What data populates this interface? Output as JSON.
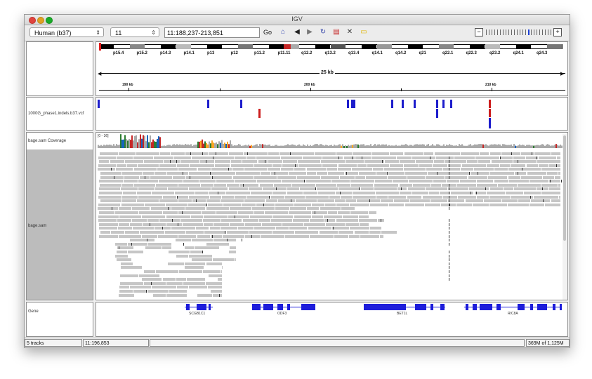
{
  "window": {
    "title": "IGV"
  },
  "toolbar": {
    "genome": "Human (b37)",
    "chromosome": "11",
    "locus": "11:188,237-213,851",
    "go_label": "Go",
    "zoom_minus": "−",
    "zoom_plus": "+"
  },
  "ideogram": {
    "bands": [
      "p15.4",
      "p15.2",
      "p14.3",
      "p14.1",
      "p13",
      "p12",
      "p11.2",
      "p11.11",
      "q12.2",
      "q13.2",
      "q13.4",
      "q14.1",
      "q14.2",
      "q21",
      "q22.1",
      "q22.3",
      "q23.2",
      "q24.1",
      "q24.3"
    ]
  },
  "ruler": {
    "span": "25 kb",
    "ticks": [
      "190 kb",
      "200 kb",
      "210 kb"
    ]
  },
  "tracks": {
    "vcf": "1000G_phase1.indels.b37.vcf",
    "coverage": "bage.sam Coverage",
    "coverage_range": "[0 - 36]",
    "alignment": "bage.sam",
    "gene": "Gene"
  },
  "genes": [
    "SCGB1C1",
    "ODF3",
    "BET1L",
    "RIC8A"
  ],
  "status": {
    "tracks": "5 tracks",
    "position": "11:196,853",
    "memory": "369M of 1,125M"
  }
}
